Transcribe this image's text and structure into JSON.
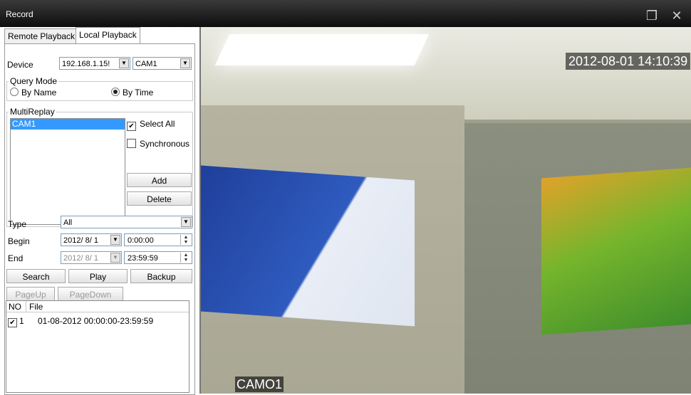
{
  "window": {
    "title": "Record",
    "restore_glyph": "❐",
    "close_glyph": "✕"
  },
  "tabs": [
    {
      "label": "Remote Playback"
    },
    {
      "label": "Local Playback"
    }
  ],
  "device": {
    "label": "Device",
    "ip": "192.168.1.15!",
    "channel": "CAM1"
  },
  "query_mode": {
    "title": "Query Mode",
    "by_name": "By Name",
    "by_time": "By Time",
    "selected": "By Time"
  },
  "multireplay": {
    "title": "MultiReplay",
    "items": [
      "CAM1"
    ],
    "select_all": "Select All",
    "select_all_checked": "✔",
    "synchronous": "Synchronous",
    "add": "Add",
    "delete": "Delete"
  },
  "filter": {
    "type_label": "Type",
    "type_value": "All",
    "begin_label": "Begin",
    "begin_date": "2012/ 8/ 1",
    "begin_time": "0:00:00",
    "end_label": "End",
    "end_date": "2012/ 8/ 1",
    "end_time": "23:59:59"
  },
  "actions": {
    "search": "Search",
    "play": "Play",
    "backup": "Backup",
    "page_up": "PageUp",
    "page_down": "PageDown"
  },
  "file_list": {
    "headers": [
      "NO",
      "File"
    ],
    "rows": [
      {
        "no": "1",
        "file": "01-08-2012 00:00:00-23:59:59",
        "checked": "✔"
      }
    ]
  },
  "video": {
    "timestamp": "2012-08-01 14:10:39",
    "camera": "CAMO1"
  }
}
